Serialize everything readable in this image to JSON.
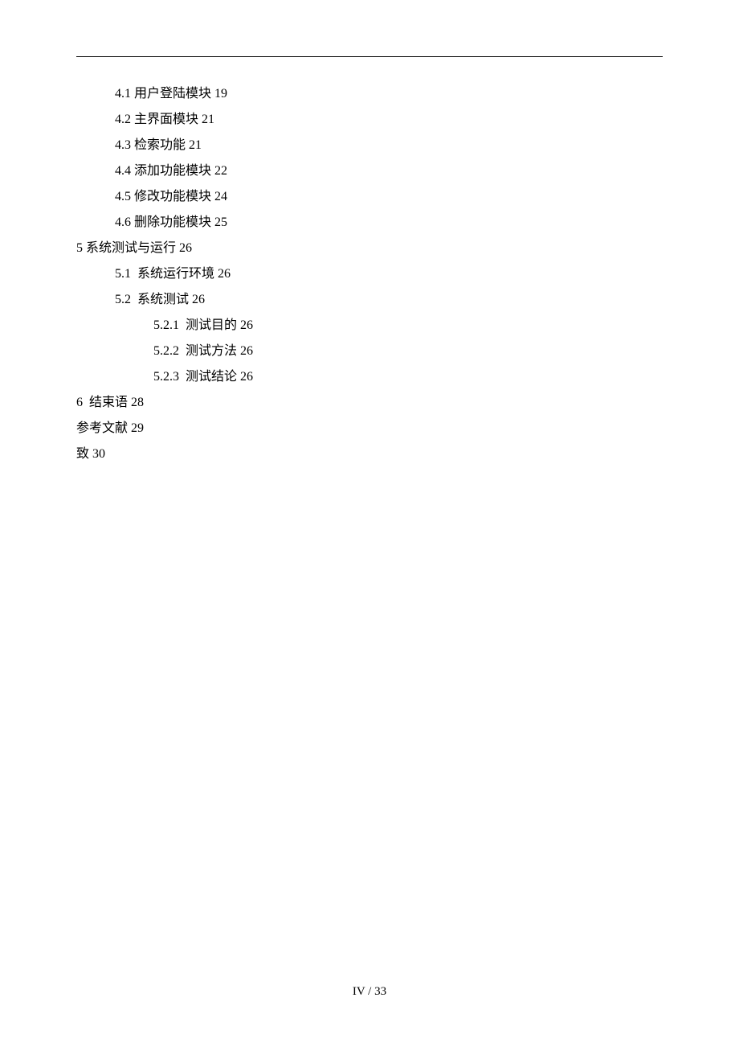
{
  "toc": {
    "entries": [
      {
        "indent": 1,
        "text": "4.1 用户登陆模块 19"
      },
      {
        "indent": 1,
        "text": "4.2 主界面模块 21"
      },
      {
        "indent": 1,
        "text": "4.3 检索功能 21"
      },
      {
        "indent": 1,
        "text": "4.4 添加功能模块 22"
      },
      {
        "indent": 1,
        "text": "4.5 修改功能模块 24"
      },
      {
        "indent": 1,
        "text": "4.6 删除功能模块 25"
      },
      {
        "indent": 0,
        "text": "5 系统测试与运行 26"
      },
      {
        "indent": 1,
        "text": "5.1  系统运行环境 26"
      },
      {
        "indent": 1,
        "text": "5.2  系统测试 26"
      },
      {
        "indent": 2,
        "text": "5.2.1  测试目的 26"
      },
      {
        "indent": 2,
        "text": "5.2.2  测试方法 26"
      },
      {
        "indent": 2,
        "text": "5.2.3  测试结论 26"
      },
      {
        "indent": 0,
        "text": "6  结束语 28"
      },
      {
        "indent": 0,
        "text": "参考文献 29"
      },
      {
        "indent": 0,
        "text": "致 30"
      }
    ]
  },
  "footer": {
    "page_label": "IV / 33"
  }
}
